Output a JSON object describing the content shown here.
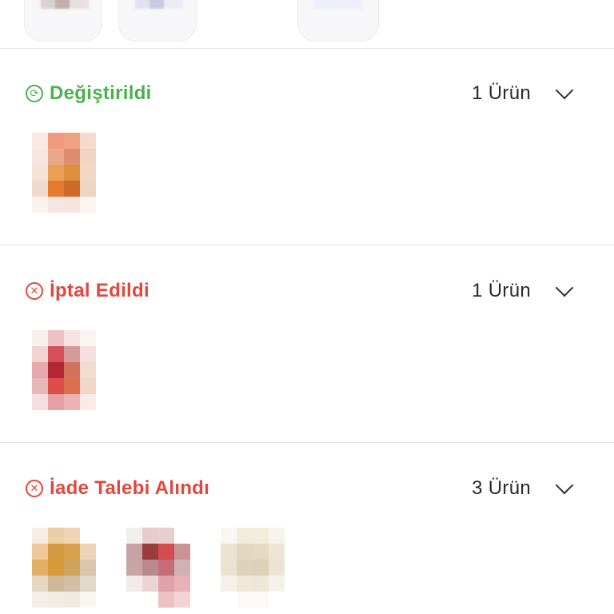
{
  "colors": {
    "changed": "#4caf50",
    "cancelled": "#e0483e",
    "text": "#2a2a2a",
    "divider": "#e4e4e4"
  },
  "sections": [
    {
      "status": "Değiştirildi",
      "icon": "refresh-icon",
      "count": "1 Ürün",
      "products": [
        {
          "colors": [
            "#fbe9e3",
            "#f09a7e",
            "#f0a283",
            "#f6dacf",
            "#f7e6df",
            "#e9a88b",
            "#de8d6e",
            "#f1d4c4",
            "#f6e3d4",
            "#eca054",
            "#de8f3a",
            "#f0d8c4",
            "#efd9d0",
            "#e57b2e",
            "#cc6a2a",
            "#eed4c2",
            "#fbf2ee",
            "#f5e6e2",
            "#f4e4df",
            "#fbf4f1"
          ]
        }
      ]
    },
    {
      "status": "İptal Edildi",
      "icon": "cancel-icon",
      "count": "1 Ürün",
      "products": [
        {
          "colors": [
            "#fbeeee",
            "#ecc2c4",
            "#f7e2e2",
            "#fcf3f3",
            "#f1d3d4",
            "#d84e59",
            "#d59a9b",
            "#f4e0df",
            "#e7a8ab",
            "#b32734",
            "#d2735e",
            "#f0dcd0",
            "#e8b7b9",
            "#de4c4b",
            "#d8724e",
            "#f0d8c8",
            "#f6dfe0",
            "#e9a0a4",
            "#ecb4b2",
            "#f8ebe8"
          ]
        }
      ]
    },
    {
      "status": "İade Talebi Alındı",
      "icon": "cancel-icon",
      "count": "3 Ürün",
      "products": [
        {
          "colors": [
            "#f6ede6",
            "#eccfa6",
            "#f1d5b3",
            "#ffffff",
            "#eec89a",
            "#d59a3f",
            "#d8a24f",
            "#ecd2b6",
            "#e2b065",
            "#d7993a",
            "#cfa25d",
            "#dcc7ad",
            "#e6d6c4",
            "#cfb79a",
            "#d3bea5",
            "#e3d8cc",
            "#f3eee8",
            "#f3ece5",
            "#f1eae3",
            "#faf7f3"
          ]
        },
        {
          "colors": [
            "#f3eeee",
            "#e6cccc",
            "#e7cfd0",
            "#ffffff",
            "#c8a3a4",
            "#9a3c3d",
            "#d24c52",
            "#c89495",
            "#c7a5a6",
            "#b98a8d",
            "#c66d78",
            "#d1b2b4",
            "#f4eaea",
            "#ebd4d6",
            "#dea3aa",
            "#e7b2b7",
            "#ffffff",
            "#ffffff",
            "#ecc1c6",
            "#f2d4d8"
          ]
        },
        {
          "colors": [
            "#faf7f1",
            "#f1ecdc",
            "#f2ecda",
            "#f7f3ea",
            "#ebe3d0",
            "#e2d6bf",
            "#e4d9c3",
            "#eee6d5",
            "#eae3d1",
            "#ddd2ba",
            "#dcd2b9",
            "#ebe4d3",
            "#f5f1e8",
            "#efe8d9",
            "#ede7d8",
            "#f6f2ea",
            "#ffffff",
            "#fbfaf6",
            "#fbfaf6",
            "#ffffff"
          ]
        }
      ]
    }
  ]
}
